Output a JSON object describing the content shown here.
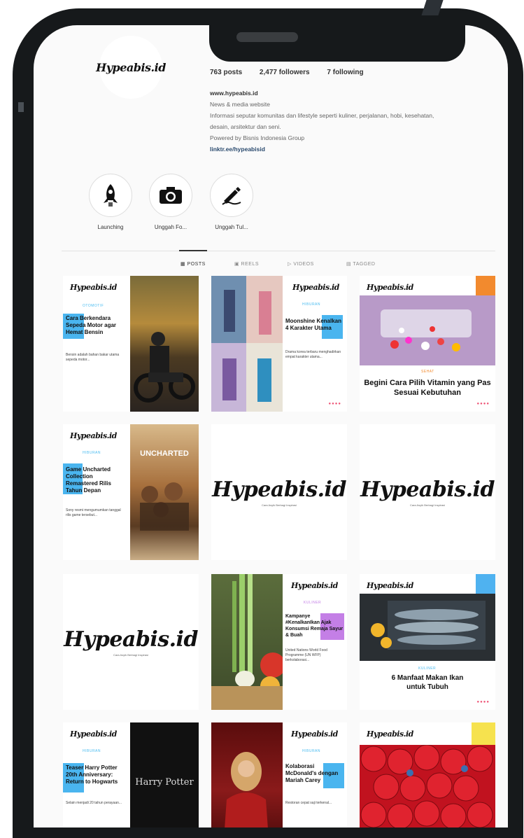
{
  "profile": {
    "avatar_logo": "Hypeabis.id",
    "posts": "763 posts",
    "followers": "2,477 followers",
    "following": "7 following",
    "website_title": "www.hypeabis.id",
    "category": "News & media website",
    "bio_line1": "Informasi seputar komunitas dan lifestyle seperti kuliner, perjalanan, hobi, kesehatan,",
    "bio_line2": "desain, arsitektur dan seni.",
    "bio_line3": "Powered by Bisnis Indonesia Group",
    "link": "linktr.ee/hypeabisid"
  },
  "highlights": [
    {
      "label": "Launching",
      "icon": "rocket-icon"
    },
    {
      "label": "Unggah Fo...",
      "icon": "camera-icon"
    },
    {
      "label": "Unggah Tul...",
      "icon": "pen-writing-icon"
    }
  ],
  "tabs": {
    "posts": "▦ POSTS",
    "reels": "▣ REELS",
    "videos": "▷ VIDEOS",
    "tagged": "▤ TAGGED"
  },
  "posts": {
    "p1": {
      "brand": "Hypeabis.id",
      "tag": "OTOMOTIF",
      "headline": "Cara Berkendara Sepeda Motor agar Hemat Bensin",
      "body": "Bensin adalah bahan bakar utama sepeda motor..."
    },
    "p2": {
      "brand": "Hypeabis.id",
      "tag": "HIBURAN",
      "headline": "Moonshine Kenalkan 4 Karakter Utama",
      "body": "Drama korea terbaru menghadirkan empat karakter utama..."
    },
    "p3": {
      "brand": "Hypeabis.id",
      "tag": "SEHAT",
      "headline": "Begini Cara Pilih Vitamin yang Pas Sesuai Kebutuhan"
    },
    "p4": {
      "brand": "Hypeabis.id",
      "tag": "HIBURAN",
      "headline": "Game Uncharted Collection Remastered Rilis Tahun Depan",
      "poster_title": "UNCHARTED",
      "body": "Sony resmi mengumumkan tanggal rilis game tersebut..."
    },
    "p5": {
      "logo": "Hypeabis.id",
      "sub": "Cara Asyik Berbagi Inspirasi"
    },
    "p6": {
      "logo": "Hypeabis.id",
      "sub": "Cara Asyik Berbagi Inspirasi"
    },
    "p7": {
      "logo": "Hypeabis.id",
      "sub": "Cara Asyik Berbagi Inspirasi"
    },
    "p8": {
      "brand": "Hypeabis.id",
      "tag": "KULINER",
      "headline": "Kampanye #KenalkanIkan Ajak Konsumsi Remaja Sayur & Buah",
      "body": "United Nations World Food Programme (UN WFP) berkolaborasi..."
    },
    "p9": {
      "brand": "Hypeabis.id",
      "tag": "KULINER",
      "headline": "6 Manfaat Makan Ikan untuk Tubuh"
    },
    "p10": {
      "brand": "Hypeabis.id",
      "tag": "HIBURAN",
      "headline": "Teaser Harry Potter 20th Anniversary: Return to Hogwarts",
      "poster_title": "Harry Potter",
      "body": "Selain menjadi 20 tahun perayaan..."
    },
    "p11": {
      "brand": "Hypeabis.id",
      "tag": "HIBURAN",
      "headline": "Kolaborasi McDonald's dengan Mariah Carey",
      "body": "Restoran cepat saji terkenal..."
    },
    "p12": {
      "brand": "Hypeabis.id"
    }
  },
  "colors": {
    "accent_blue": "#4ab5ef",
    "orange_square": "#f28a2e",
    "blue_square": "#4fb2f0",
    "yellow_square": "#f6e24e",
    "purple_box": "#c47fe6"
  }
}
